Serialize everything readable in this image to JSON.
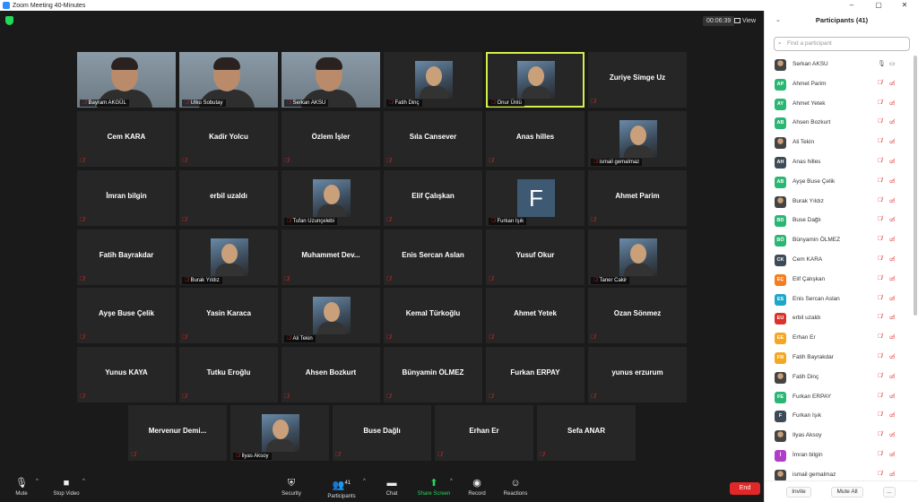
{
  "window": {
    "title": "Zoom Meeting 40-Minutes",
    "controls": [
      "–",
      "▢",
      "✕"
    ]
  },
  "meeting": {
    "elapsed": "00:06:39",
    "view_label": "View"
  },
  "tiles": [
    {
      "name": "Bayram AKGÜL",
      "mode": "video"
    },
    {
      "name": "Utku Sobutay",
      "mode": "video"
    },
    {
      "name": "Serkan AKSU",
      "mode": "video"
    },
    {
      "name": "Fatih Dinç",
      "mode": "photo"
    },
    {
      "name": "Onur Ünlü",
      "mode": "photo",
      "active": true
    },
    {
      "name": "Zuriye Simge Uz",
      "mode": "text"
    },
    {
      "name": "Cem KARA",
      "mode": "text"
    },
    {
      "name": "Kadir Yolcu",
      "mode": "text"
    },
    {
      "name": "Özlem İşler",
      "mode": "text"
    },
    {
      "name": "Sıla Cansever",
      "mode": "text"
    },
    {
      "name": "Anas hilles",
      "mode": "text"
    },
    {
      "name": "ismail gemalmaz",
      "mode": "photo"
    },
    {
      "name": "İmran bilgin",
      "mode": "text"
    },
    {
      "name": "erbil uzaldı",
      "mode": "text"
    },
    {
      "name": "Tufan Uzunçelebi",
      "mode": "photo"
    },
    {
      "name": "Elif Çalışkan",
      "mode": "text"
    },
    {
      "name": "Furkan Işık",
      "mode": "letter",
      "letter": "F"
    },
    {
      "name": "Ahmet Parim",
      "mode": "text"
    },
    {
      "name": "Fatih Bayrakdar",
      "mode": "text"
    },
    {
      "name": "Burak Yıldız",
      "mode": "photo"
    },
    {
      "name": "Muhammet  Dev...",
      "mode": "text"
    },
    {
      "name": "Enis Sercan Aslan",
      "mode": "text"
    },
    {
      "name": "Yusuf Okur",
      "mode": "text"
    },
    {
      "name": "Taner Cakir",
      "mode": "photo"
    },
    {
      "name": "Ayşe Buse Çelik",
      "mode": "text"
    },
    {
      "name": "Yasin Karaca",
      "mode": "text"
    },
    {
      "name": "Ali Tekin",
      "mode": "photo"
    },
    {
      "name": "Kemal Türkoğlu",
      "mode": "text"
    },
    {
      "name": "Ahmet Yetek",
      "mode": "text"
    },
    {
      "name": "Ozan Sönmez",
      "mode": "text"
    },
    {
      "name": "Yunus KAYA",
      "mode": "text"
    },
    {
      "name": "Tutku Eroğlu",
      "mode": "text"
    },
    {
      "name": "Ahsen Bozkurt",
      "mode": "text"
    },
    {
      "name": "Bünyamin ÖLMEZ",
      "mode": "text"
    },
    {
      "name": "Furkan ERPAY",
      "mode": "text"
    },
    {
      "name": "yunus erzurum",
      "mode": "text"
    },
    {
      "name": "Mervenur  Demi...",
      "mode": "text"
    },
    {
      "name": "Ilyas Aksoy",
      "mode": "photo"
    },
    {
      "name": "Buse Dağlı",
      "mode": "text"
    },
    {
      "name": "Erhan Er",
      "mode": "text"
    },
    {
      "name": "Sefa ANAR",
      "mode": "text"
    }
  ],
  "toolbar": {
    "mute": "Mute",
    "stop_video": "Stop Video",
    "security": "Security",
    "participants": "Participants",
    "participants_count": "41",
    "chat": "Chat",
    "share_screen": "Share Screen",
    "record": "Record",
    "reactions": "Reactions",
    "end": "End"
  },
  "panel": {
    "title": "Participants (41)",
    "search_placeholder": "Find a participant",
    "invite": "Invite",
    "mute_all": "Mute All",
    "more": "...",
    "colors": {
      "muted": "#e02828"
    },
    "participants": [
      {
        "name": "Serkan AKSU",
        "initials": "",
        "color": "",
        "photo": true,
        "mic_on": true,
        "video_on": true
      },
      {
        "name": "Ahmet Parim",
        "initials": "AP",
        "color": "#2bb673"
      },
      {
        "name": "Ahmet Yetek",
        "initials": "AY",
        "color": "#2bb673"
      },
      {
        "name": "Ahsen Bozkurt",
        "initials": "AB",
        "color": "#2bb673"
      },
      {
        "name": "Ali Tekin",
        "initials": "",
        "color": "",
        "photo": true
      },
      {
        "name": "Anas hilles",
        "initials": "AH",
        "color": "#3d4b57"
      },
      {
        "name": "Ayşe Buse Çelik",
        "initials": "AB",
        "color": "#2bb673"
      },
      {
        "name": "Burak Yıldız",
        "initials": "",
        "color": "",
        "photo": true
      },
      {
        "name": "Buse Dağlı",
        "initials": "BD",
        "color": "#2bb673"
      },
      {
        "name": "Bünyamin ÖLMEZ",
        "initials": "BÖ",
        "color": "#2bb673"
      },
      {
        "name": "Cem KARA",
        "initials": "CK",
        "color": "#3d4b57"
      },
      {
        "name": "Elif Çalışkan",
        "initials": "EÇ",
        "color": "#f57c1f"
      },
      {
        "name": "Enis Sercan Aslan",
        "initials": "ES",
        "color": "#1fa7c9"
      },
      {
        "name": "erbil uzaldı",
        "initials": "EU",
        "color": "#d9342b"
      },
      {
        "name": "Erhan Er",
        "initials": "EE",
        "color": "#f5a623"
      },
      {
        "name": "Fatih Bayrakdar",
        "initials": "FB",
        "color": "#f5a623"
      },
      {
        "name": "Fatih Dinç",
        "initials": "",
        "color": "",
        "photo": true
      },
      {
        "name": "Furkan ERPAY",
        "initials": "FE",
        "color": "#2bb673"
      },
      {
        "name": "Furkan Işık",
        "initials": "F",
        "color": "#3d4b57"
      },
      {
        "name": "Ilyas Aksoy",
        "initials": "",
        "color": "",
        "photo": true
      },
      {
        "name": "İmran bilgin",
        "initials": "İ",
        "color": "#b13cc9"
      },
      {
        "name": "ismail gemalmaz",
        "initials": "",
        "color": "",
        "photo": true
      }
    ]
  }
}
